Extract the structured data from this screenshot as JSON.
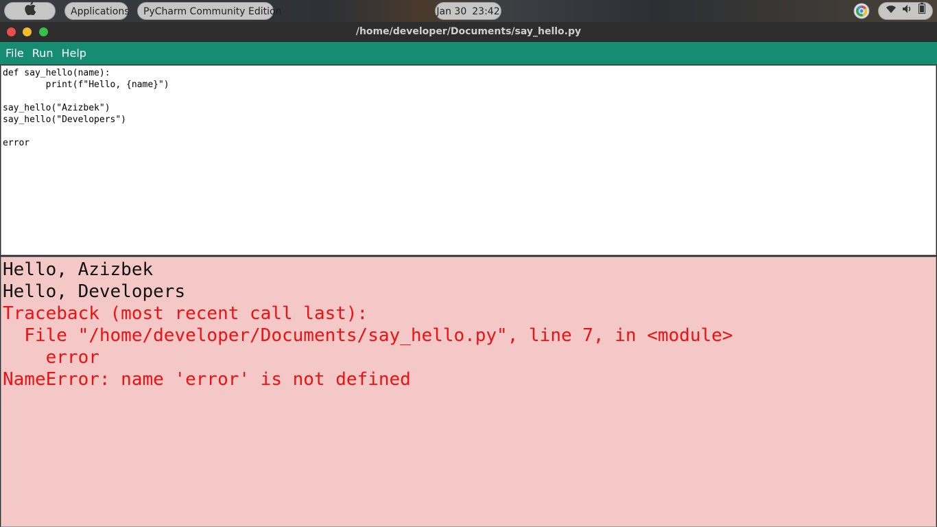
{
  "panel": {
    "applications_label": "Applications",
    "active_app_label": "PyCharm Community Edition",
    "date": "Jan 30",
    "time": "23:42",
    "icons": [
      "apple-icon",
      "chrome-icon",
      "wifi-icon",
      "volume-icon",
      "battery-icon"
    ]
  },
  "window": {
    "title": "/home/developer/Documents/say_hello.py"
  },
  "menu": {
    "file": "File",
    "run": "Run",
    "help": "Help",
    "accent_color": "#168d72"
  },
  "editor": {
    "lines": [
      "def say_hello(name):",
      "        print(f\"Hello, {name}\")",
      "",
      "say_hello(\"Azizbek\")",
      "say_hello(\"Developers\")",
      "",
      "error"
    ]
  },
  "output": {
    "background": "#f5c8c8",
    "lines": [
      {
        "text": "Hello, Azizbek",
        "color": "#111111"
      },
      {
        "text": "Hello, Developers",
        "color": "#111111"
      },
      {
        "text": "Traceback (most recent call last):",
        "color": "#ee1111"
      },
      {
        "text": "  File \"/home/developer/Documents/say_hello.py\", line 7, in <module>",
        "color": "#ee1111"
      },
      {
        "text": "    error",
        "color": "#ee1111"
      },
      {
        "text": "NameError: name 'error' is not defined",
        "color": "#ee1111"
      }
    ]
  }
}
